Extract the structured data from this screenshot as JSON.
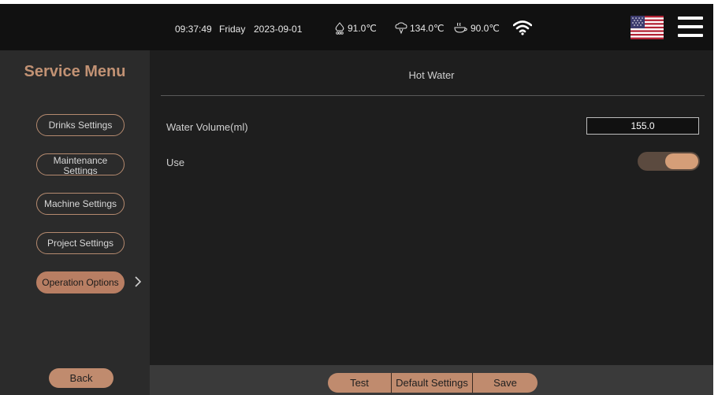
{
  "status_bar": {
    "time": "09:37:49",
    "day": "Friday",
    "date": "2023-09-01",
    "temperatures": [
      {
        "icon": "boiler-icon",
        "value": "91.0℃"
      },
      {
        "icon": "steam-icon",
        "value": "134.0℃"
      },
      {
        "icon": "cup-heater-icon",
        "value": "90.0℃"
      }
    ],
    "wifi_icon": "wifi-icon",
    "language_flag": "us-flag-icon",
    "menu_icon": "hamburger-menu-icon"
  },
  "sidebar": {
    "title": "Service Menu",
    "items": [
      {
        "label": "Drinks Settings",
        "active": false
      },
      {
        "label": "Maintenance Settings",
        "active": false
      },
      {
        "label": "Machine Settings",
        "active": false
      },
      {
        "label": "Project Settings",
        "active": false
      },
      {
        "label": "Operation Options",
        "active": true
      }
    ],
    "back_label": "Back"
  },
  "main": {
    "title": "Hot Water",
    "water_volume": {
      "label": "Water Volume(ml)",
      "value": "155.0"
    },
    "use": {
      "label": "Use",
      "enabled": true
    }
  },
  "bottom_bar": {
    "test_label": "Test",
    "default_label": "Default Settings",
    "save_label": "Save"
  },
  "colors": {
    "accent": "#c08b6e",
    "title": "#c29274",
    "background": "#1e1e1e",
    "sidebar": "#2b2b2b"
  }
}
